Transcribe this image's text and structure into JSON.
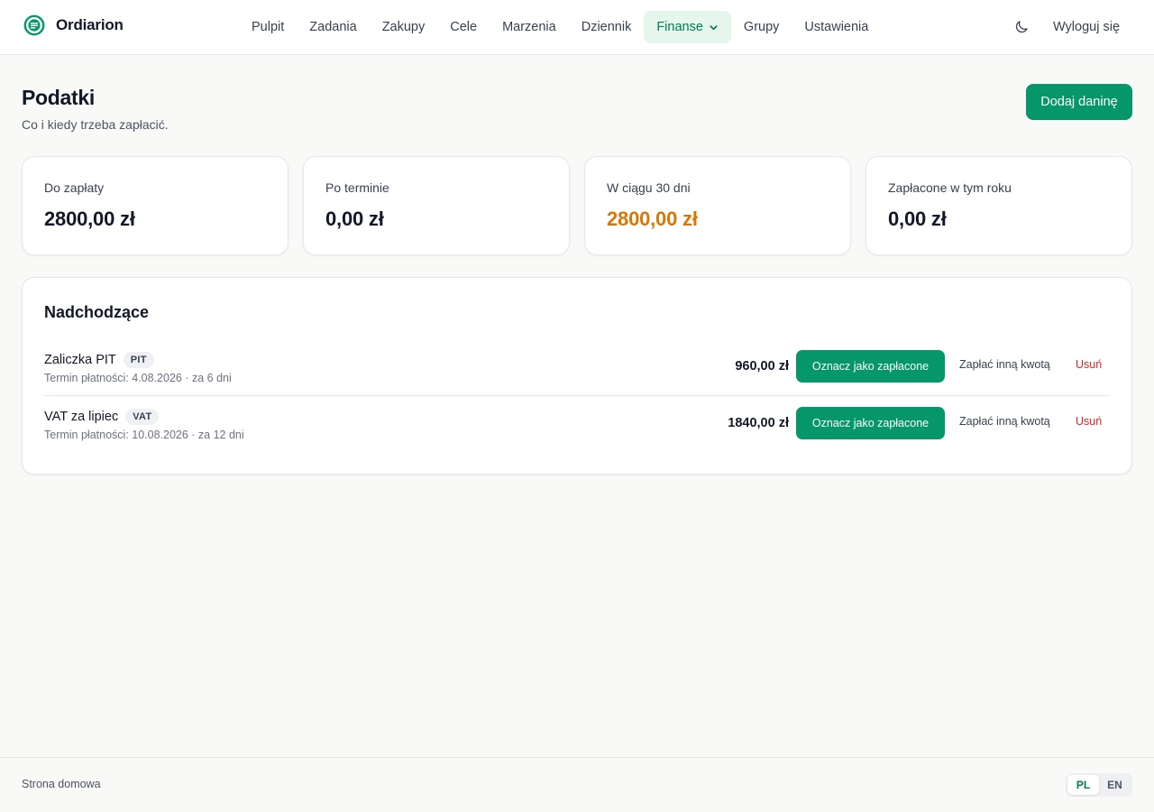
{
  "app": {
    "name": "Ordiarion",
    "logo_icon": "list-circle-icon",
    "accent_color": "#059669"
  },
  "nav": {
    "items": [
      {
        "label": "Pulpit"
      },
      {
        "label": "Zadania"
      },
      {
        "label": "Zakupy"
      },
      {
        "label": "Cele"
      },
      {
        "label": "Marzenia"
      },
      {
        "label": "Dziennik"
      },
      {
        "label": "Finanse",
        "active": true,
        "has_dropdown": true
      },
      {
        "label": "Grupy"
      },
      {
        "label": "Ustawienia"
      }
    ],
    "theme_icon": "moon-icon",
    "logout_label": "Wyloguj się"
  },
  "page": {
    "title": "Podatki",
    "subtitle": "Co i kiedy trzeba zapłacić.",
    "add_button_label": "Dodaj daninę"
  },
  "stats": [
    {
      "label": "Do zapłaty",
      "value": "2800,00 zł"
    },
    {
      "label": "Po terminie",
      "value": "0,00 zł"
    },
    {
      "label": "W ciągu 30 dni",
      "value": "2800,00 zł",
      "color": "#d97706"
    },
    {
      "label": "Zapłacone w tym roku",
      "value": "0,00 zł"
    }
  ],
  "upcoming": {
    "title": "Nadchodzące",
    "items": [
      {
        "name": "Zaliczka PIT",
        "badge": "PIT",
        "meta": "Termin płatności: 4.08.2026 · za 6 dni",
        "amount": "960,00 zł",
        "mark_paid_label": "Oznacz jako zapłacone",
        "other_amount_label": "Zapłać inną kwotą",
        "delete_label": "Usuń"
      },
      {
        "name": "VAT za lipiec",
        "badge": "VAT",
        "meta": "Termin płatności: 10.08.2026 · za 12 dni",
        "amount": "1840,00 zł",
        "mark_paid_label": "Oznacz jako zapłacone",
        "other_amount_label": "Zapłać inną kwotą",
        "delete_label": "Usuń"
      }
    ]
  },
  "footer": {
    "home_link": "Strona domowa",
    "languages": [
      {
        "label": "PL",
        "active": true
      },
      {
        "label": "EN"
      }
    ]
  }
}
